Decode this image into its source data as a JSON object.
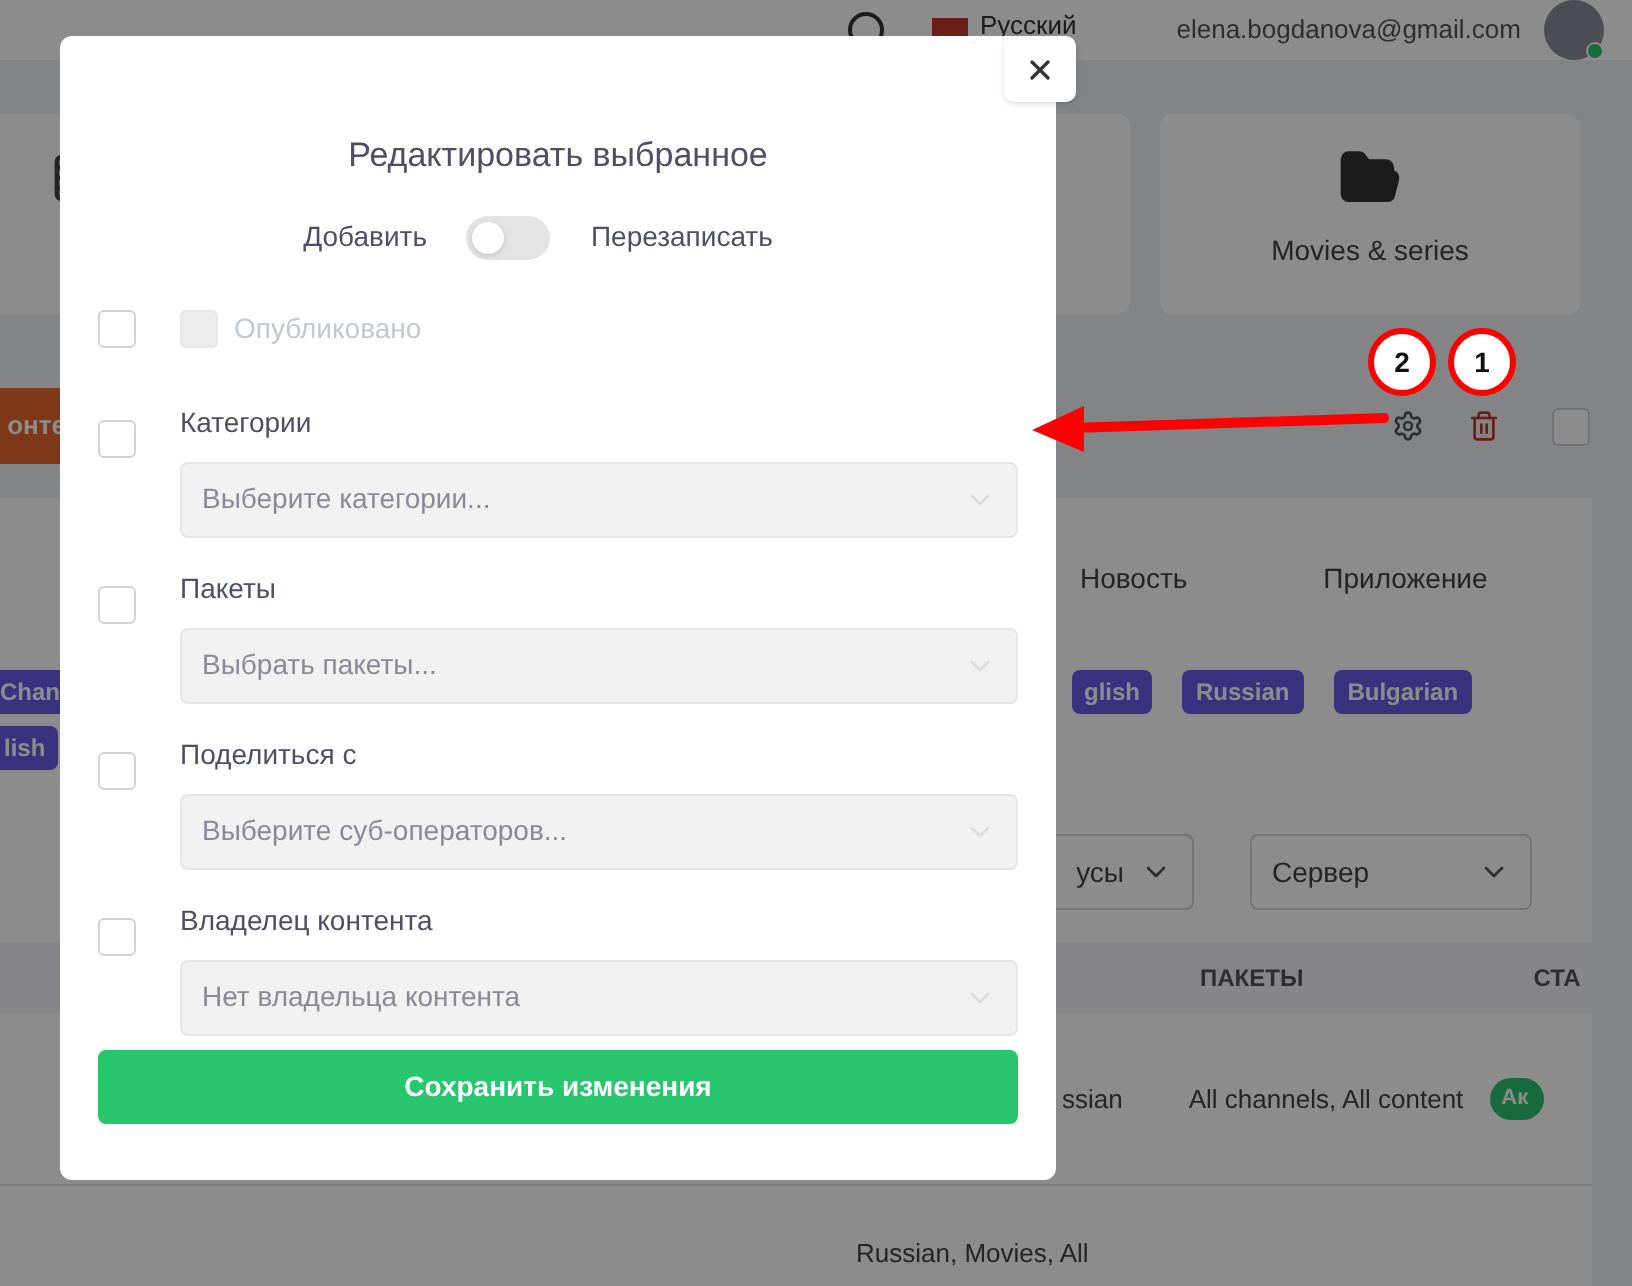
{
  "header": {
    "language": "Русский",
    "email": "elena.bogdanova@gmail.com"
  },
  "cards": [
    {
      "label": "Movies & series"
    }
  ],
  "add_button": {
    "label": "онте"
  },
  "annotations": [
    {
      "number": "2"
    },
    {
      "number": "1"
    }
  ],
  "tabs": [
    {
      "label": "Новость",
      "selected": false
    },
    {
      "label": "Приложение",
      "selected": false
    }
  ],
  "tags": [
    {
      "label": "Chan"
    },
    {
      "label": "glish"
    },
    {
      "label": "Russian"
    },
    {
      "label": "Bulgarian"
    },
    {
      "label": "lish"
    }
  ],
  "filters": [
    {
      "value": "усы"
    },
    {
      "value": "Сервер"
    }
  ],
  "select_all": {
    "checked": false
  },
  "table": {
    "columns": {
      "packages": "ПАКЕТЫ",
      "status": "СТА"
    },
    "rows": [
      {
        "column_1": "ssian",
        "packages": "All channels, All content",
        "status": "Ак"
      },
      {
        "column_1": "Russian, Movies, All"
      }
    ]
  },
  "modal": {
    "title": "Редактировать выбранное",
    "mode": {
      "left": "Добавить",
      "right": "Перезаписать",
      "on": false
    },
    "rows": [
      {
        "kind": "flag",
        "label": "Опубликовано",
        "checked": false,
        "flag_checked": false,
        "disabled": true
      },
      {
        "kind": "select",
        "label": "Категории",
        "placeholder": "Выберите категории...",
        "checked": false
      },
      {
        "kind": "select",
        "label": "Пакеты",
        "placeholder": "Выбрать пакеты...",
        "checked": false
      },
      {
        "kind": "select",
        "label": "Поделиться с",
        "placeholder": "Выберите суб-операторов...",
        "checked": false
      },
      {
        "kind": "select",
        "label": "Владелец контента",
        "placeholder": "Нет владельца контента",
        "checked": false
      }
    ],
    "save": "Сохранить изменения"
  }
}
